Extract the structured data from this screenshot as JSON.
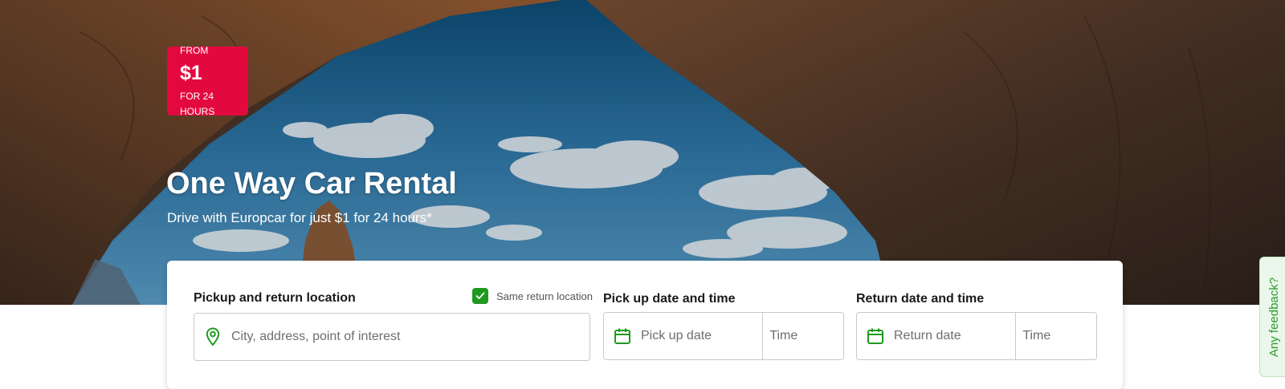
{
  "hero": {
    "badge": {
      "from": "FROM",
      "price": "$1",
      "duration": "FOR 24 HOURS"
    },
    "title": "One Way Car Rental",
    "subtitle": "Drive with Europcar for just $1 for 24 hours*"
  },
  "search": {
    "pickup_label": "Pickup and return location",
    "same_return_label": "Same return location",
    "same_return_checked": true,
    "location_placeholder": "City, address, point of interest",
    "pickup_datetime_label": "Pick up date and time",
    "pickup_date_placeholder": "Pick up date",
    "pickup_time_placeholder": "Time",
    "return_datetime_label": "Return date and time",
    "return_date_placeholder": "Return date",
    "return_time_placeholder": "Time"
  },
  "feedback": {
    "label": "Any feedback?"
  },
  "colors": {
    "badge": "#e3093f",
    "accent_green": "#1f9a1f"
  },
  "icons": [
    "location-pin-icon",
    "calendar-icon",
    "checkmark-icon"
  ]
}
